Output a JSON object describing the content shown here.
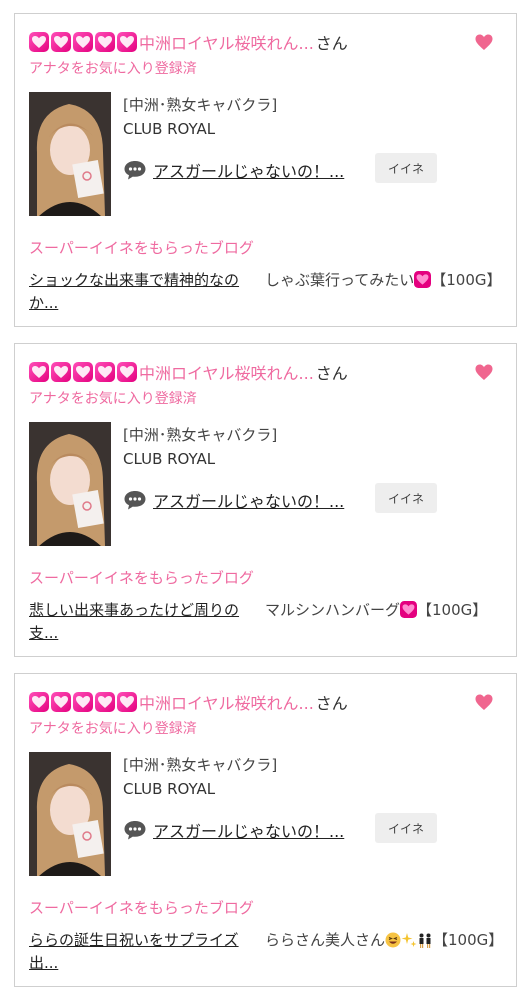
{
  "cards": [
    {
      "shop_name": "中洲ロイヤル桜咲れん...",
      "honorific": "さん",
      "fav_status": "アナタをお気に入り登録済",
      "category": "[中洲･熟女キャバクラ]",
      "club": "CLUB ROYAL",
      "blog_title": "アスガールじゃないの！...",
      "iine_label": "イイネ",
      "section_label": "スーパーイイネをもらったブログ",
      "super_blog_title": "ショックな出来事で精神的なのか...",
      "gift_text": "しゃぶ葉行ってみたい",
      "gift_suffix": "【100G】"
    },
    {
      "shop_name": "中洲ロイヤル桜咲れん...",
      "honorific": "さん",
      "fav_status": "アナタをお気に入り登録済",
      "category": "[中洲･熟女キャバクラ]",
      "club": "CLUB ROYAL",
      "blog_title": "アスガールじゃないの！...",
      "iine_label": "イイネ",
      "section_label": "スーパーイイネをもらったブログ",
      "super_blog_title": "悲しい出来事あったけど周りの支...",
      "gift_text": "マルシンハンバーグ",
      "gift_suffix": "【100G】"
    },
    {
      "shop_name": "中洲ロイヤル桜咲れん...",
      "honorific": "さん",
      "fav_status": "アナタをお気に入り登録済",
      "category": "[中洲･熟女キャバクラ]",
      "club": "CLUB ROYAL",
      "blog_title": "アスガールじゃないの！...",
      "iine_label": "イイネ",
      "section_label": "スーパーイイネをもらったブログ",
      "super_blog_title": "ららの誕生日祝いをサプライズ出...",
      "gift_text": "ららさん美人さん",
      "gift_suffix": "【100G】"
    }
  ],
  "colors": {
    "accent_pink": "#ef6aa0",
    "heart_magenta": "#e4007f",
    "fav_heart": "#f0668f",
    "border": "#cfcfcf"
  },
  "icons": [
    "heart-icon",
    "favorite-heart-icon",
    "speech-bubble-icon",
    "grin-emoji",
    "sparkles-emoji",
    "dancers-emoji"
  ]
}
